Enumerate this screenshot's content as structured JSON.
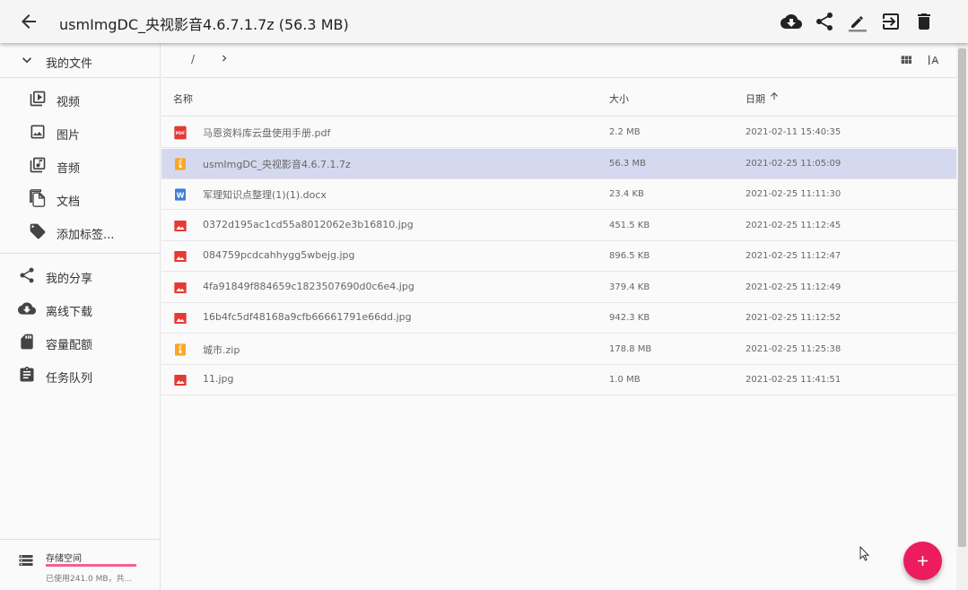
{
  "appbar": {
    "title": "usmImgDC_央视影音4.6.7.1.7z (56.3 MB)",
    "actions": [
      "download-icon",
      "share-icon",
      "rename-icon",
      "move-icon",
      "delete-icon"
    ]
  },
  "sidebar": {
    "root_label": "我的文件",
    "filters": [
      {
        "label": "视频",
        "icon": "video-icon"
      },
      {
        "label": "图片",
        "icon": "image-icon"
      },
      {
        "label": "音频",
        "icon": "audio-icon"
      },
      {
        "label": "文档",
        "icon": "document-icon"
      },
      {
        "label": "添加标签...",
        "icon": "add-tag-icon"
      }
    ],
    "items": [
      {
        "label": "我的分享",
        "icon": "share-icon"
      },
      {
        "label": "离线下载",
        "icon": "cloud-download-icon"
      },
      {
        "label": "容量配额",
        "icon": "sd-card-icon"
      },
      {
        "label": "任务队列",
        "icon": "task-list-icon"
      }
    ],
    "storage": {
      "title": "存储空间",
      "detail": "已使用241.0 MB，共...",
      "used_fraction": 1.0,
      "bar_color": "#f06292"
    }
  },
  "breadcrumb": {
    "root": "/"
  },
  "table": {
    "headers": {
      "name": "名称",
      "size": "大小",
      "date": "日期"
    },
    "sort": {
      "column": "date",
      "direction": "ascending"
    },
    "rows": [
      {
        "name": "马恩资料库云盘使用手册.pdf",
        "size": "2.2 MB",
        "date": "2021-02-11 15:40:35",
        "type": "pdf",
        "selected": false
      },
      {
        "name": "usmImgDC_央视影音4.6.7.1.7z",
        "size": "56.3 MB",
        "date": "2021-02-25 11:05:09",
        "type": "archive",
        "selected": true
      },
      {
        "name": "军理知识点整理(1)(1).docx",
        "size": "23.4 KB",
        "date": "2021-02-25 11:11:30",
        "type": "word",
        "selected": false
      },
      {
        "name": "0372d195ac1cd55a8012062e3b16810.jpg",
        "size": "451.5 KB",
        "date": "2021-02-25 11:12:45",
        "type": "image",
        "selected": false
      },
      {
        "name": "084759pcdcahhygg5wbejg.jpg",
        "size": "896.5 KB",
        "date": "2021-02-25 11:12:47",
        "type": "image",
        "selected": false
      },
      {
        "name": "4fa91849f884659c1823507690d0c6e4.jpg",
        "size": "379.4 KB",
        "date": "2021-02-25 11:12:49",
        "type": "image",
        "selected": false
      },
      {
        "name": "16b4fc5df48168a9cfb66661791e66dd.jpg",
        "size": "942.3 KB",
        "date": "2021-02-25 11:12:52",
        "type": "image",
        "selected": false
      },
      {
        "name": "城市.zip",
        "size": "178.8 MB",
        "date": "2021-02-25 11:25:38",
        "type": "archive",
        "selected": false
      },
      {
        "name": "11.jpg",
        "size": "1.0 MB",
        "date": "2021-02-25 11:41:51",
        "type": "image",
        "selected": false
      }
    ]
  },
  "colors": {
    "accent": "#ec1c5f",
    "selected_row": "#d5d9ef",
    "pdf": "#e53935",
    "archive": "#f9a825",
    "word": "#3f7fd6",
    "image": "#e53935"
  }
}
